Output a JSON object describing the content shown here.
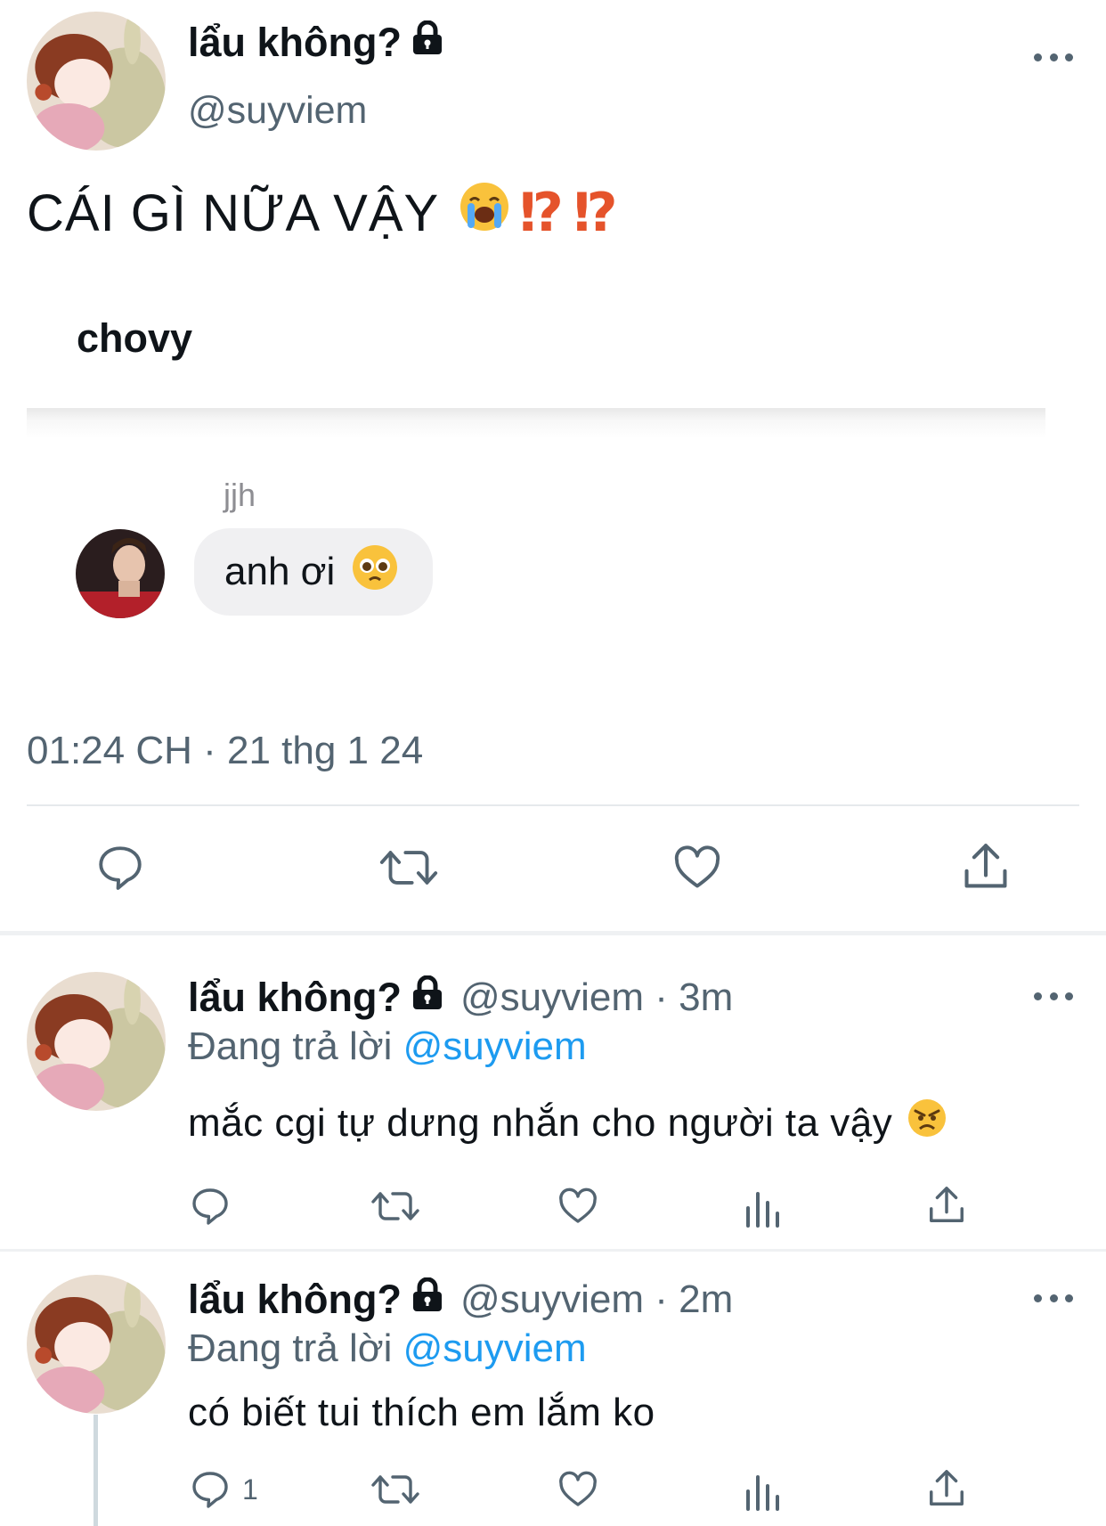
{
  "main_tweet": {
    "display_name": "lẩu không?",
    "handle": "@suyviem",
    "text": "CÁI GÌ NỮA VẬY",
    "text_emoji": "loudly-crying-face",
    "interrobang_1": "⁉",
    "interrobang_2": "⁉",
    "embed": {
      "title": "chovy",
      "sender": "jjh",
      "message": "anh ơi",
      "message_emoji": "pleading-face"
    },
    "timestamp": "01:24 CH · 21 thg 1 24"
  },
  "replies": [
    {
      "display_name": "lẩu không?",
      "handle": "@suyviem · 3m",
      "replying_prefix": "Đang trả lời ",
      "replying_to": "@suyviem",
      "text": "mắc cgi tự dưng nhắn cho người ta vậy",
      "text_emoji": "angry-face",
      "reply_count": ""
    },
    {
      "display_name": "lẩu không?",
      "handle": "@suyviem · 2m",
      "replying_prefix": "Đang trả lời ",
      "replying_to": "@suyviem",
      "text": "có biết tui thích em lắm ko",
      "reply_count": "1"
    }
  ],
  "icons": {
    "reply": "reply-icon",
    "retweet": "retweet-icon",
    "like": "heart-icon",
    "views": "views-icon",
    "share": "share-icon",
    "lock": "lock-icon",
    "more": "more-icon"
  },
  "colors": {
    "mention": "#1d9bf0",
    "secondary_text": "#536471",
    "interrobang": "#e5532b"
  }
}
